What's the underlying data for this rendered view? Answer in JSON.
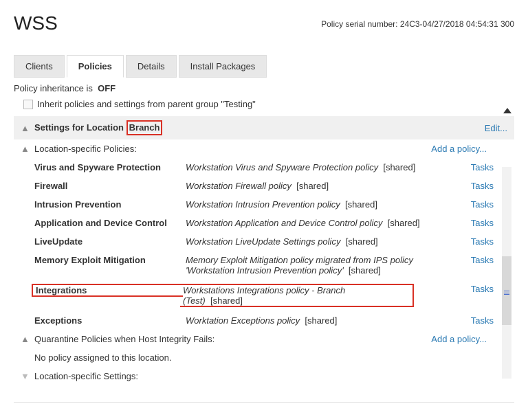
{
  "header": {
    "title": "WSS",
    "serial_label": "Policy serial number:",
    "serial_value": "24C3-04/27/2018 04:54:31 300"
  },
  "tabs": {
    "clients": "Clients",
    "policies": "Policies",
    "details": "Details",
    "install_packages": "Install Packages"
  },
  "inheritance": {
    "label_prefix": "Policy inheritance is",
    "state": "OFF",
    "checkbox_label": "Inherit policies and settings from parent group \"Testing\""
  },
  "location_bar": {
    "label_prefix": "Settings for Location",
    "location_name": "Branch",
    "edit": "Edit..."
  },
  "loc_policies": {
    "title": "Location-specific Policies:",
    "add": "Add a policy...",
    "rows": [
      {
        "name": "Virus and Spyware Protection",
        "desc": "Workstation Virus and Spyware Protection policy",
        "tag": "[shared]",
        "tasks": "Tasks"
      },
      {
        "name": "Firewall",
        "desc": "Workstation Firewall policy",
        "tag": "[shared]",
        "tasks": "Tasks"
      },
      {
        "name": "Intrusion Prevention",
        "desc": "Workstation Intrusion Prevention policy",
        "tag": "[shared]",
        "tasks": "Tasks"
      },
      {
        "name": "Application and Device Control",
        "desc": "Workstation Application and Device Control policy",
        "tag": "[shared]",
        "tasks": "Tasks"
      },
      {
        "name": "LiveUpdate",
        "desc": "Workstation LiveUpdate Settings policy",
        "tag": "[shared]",
        "tasks": "Tasks"
      },
      {
        "name": "Memory Exploit Mitigation",
        "desc": "Memory Exploit Mitigation policy migrated from IPS policy 'Workstation Intrusion Prevention policy'",
        "tag": "[shared]",
        "tasks": "Tasks"
      },
      {
        "name": "Integrations",
        "desc": "Workstations Integrations policy - Branch (Test)",
        "tag": "[shared]",
        "tasks": "Tasks"
      },
      {
        "name": "Exceptions",
        "desc": "Worktation Exceptions policy",
        "tag": "[shared]",
        "tasks": "Tasks"
      }
    ]
  },
  "quarantine": {
    "title": "Quarantine Policies when Host Integrity Fails:",
    "add": "Add a policy...",
    "none": "No policy assigned to this location."
  },
  "loc_settings": {
    "title": "Location-specific Settings:"
  }
}
